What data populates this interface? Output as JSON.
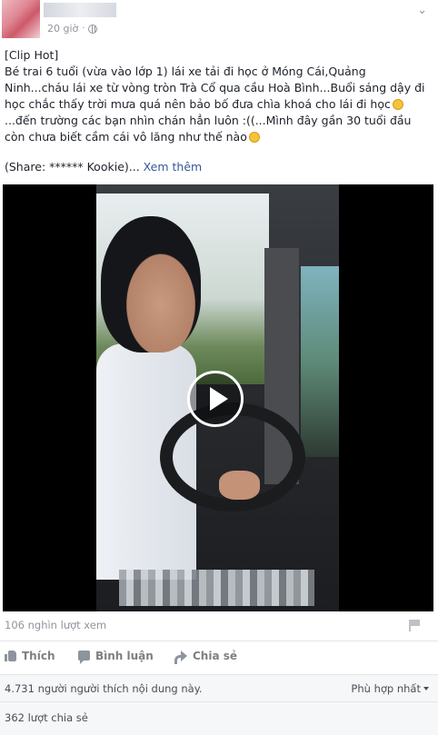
{
  "post": {
    "timestamp": "20 giờ",
    "separator": "·",
    "text_lines": [
      "[Clip Hot]",
      "Bé trai 6 tuổi (vừa vào lớp 1) lái xe tải đi học ở Móng Cái,Quảng",
      "Ninh...cháu lái xe từ vòng tròn Trà Cổ qua cầu Hoà Bình...Buổi sáng dậy đi",
      "học chắc thấy trời mưa quá nên bảo bố đưa chìa khoá cho lái đi học",
      "...đến trường các bạn nhìn chán hẳn luôn :((...Mình đây gần 30 tuổi đầu",
      "còn chưa biết cầm cái vô lăng như thế nào"
    ],
    "share_text": "(Share: ****** Kookie)...",
    "see_more": "Xem thêm"
  },
  "video": {
    "views": "106 nghìn lượt xem"
  },
  "actions": {
    "like": "Thích",
    "comment": "Bình luận",
    "share": "Chia sẻ"
  },
  "footer": {
    "likes": "4.731 người người thích nội dung này.",
    "sort": "Phù hợp nhất",
    "shares": "362 lượt chia sẻ"
  },
  "icons": {
    "privacy": "globe-icon",
    "options": "chevron-down-icon",
    "play": "play-icon",
    "report": "flag-icon",
    "like": "thumb-icon",
    "comment": "comment-icon",
    "share": "share-icon"
  },
  "colors": {
    "link": "#365899",
    "muted": "#90949c",
    "text": "#1d2129"
  }
}
